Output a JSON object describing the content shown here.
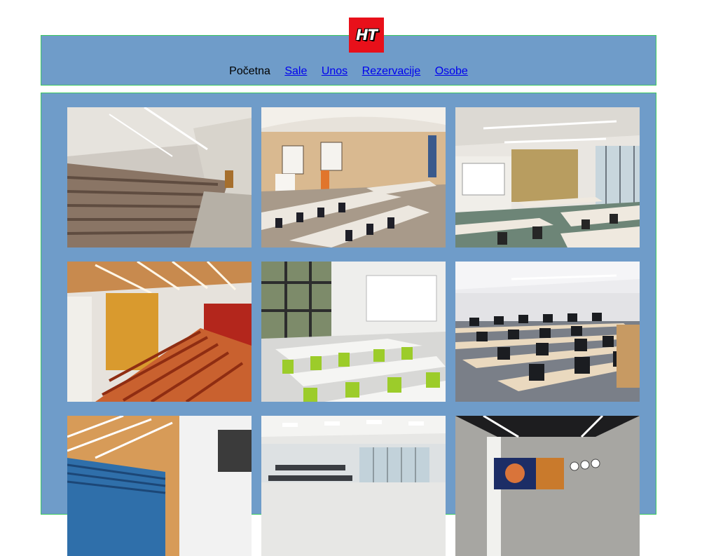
{
  "logo": {
    "text": "HT",
    "background": "#e8101a"
  },
  "nav": {
    "current": "Početna",
    "links": [
      "Sale",
      "Unos",
      "Rezervacije",
      "Osobe"
    ]
  },
  "colors": {
    "panel": "#6f9cc9",
    "border": "#3cc860",
    "link": "#0000ee"
  },
  "gallery": {
    "images": [
      {
        "name": "lecture-hall-beige-seats"
      },
      {
        "name": "lecture-room-wood-desks"
      },
      {
        "name": "classroom-whiteboard-tables"
      },
      {
        "name": "auditorium-orange-seats"
      },
      {
        "name": "classroom-green-chairs"
      },
      {
        "name": "computer-lab"
      },
      {
        "name": "auditorium-blue-seats"
      },
      {
        "name": "classroom-rows-windows"
      },
      {
        "name": "room-space-mural"
      }
    ]
  }
}
